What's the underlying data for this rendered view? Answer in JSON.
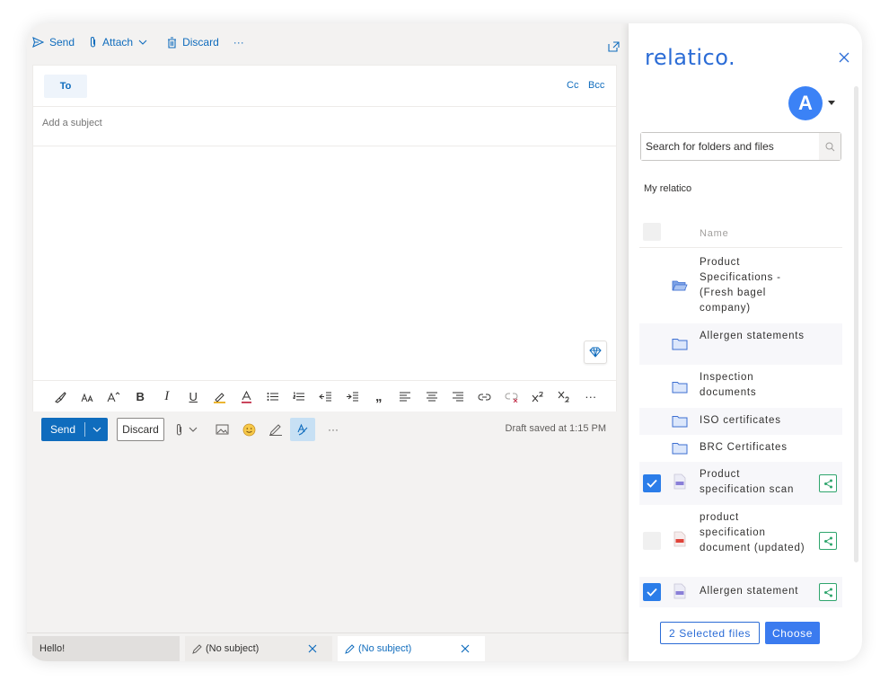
{
  "compose": {
    "commands": {
      "send": "Send",
      "attach": "Attach",
      "discard": "Discard",
      "more": "···"
    },
    "to_label": "To",
    "cc_label": "Cc",
    "bcc_label": "Bcc",
    "subject_placeholder": "Add a subject",
    "format": {
      "bold": "B",
      "italic": "I",
      "underline": "U",
      "quote": "„",
      "more": "···"
    },
    "actions": {
      "send": "Send",
      "discard": "Discard",
      "more": "···"
    },
    "draft_status": "Draft saved at 1:15 PM"
  },
  "tabs": [
    {
      "label": "Hello!"
    },
    {
      "label": "(No subject)"
    },
    {
      "label": "(No subject)"
    }
  ],
  "relatico": {
    "brand": "relatico.",
    "avatar_initial": "A",
    "search_placeholder": "Search for folders and files",
    "section_title": "My relatico",
    "name_header": "Name",
    "items": [
      {
        "label": "Product Specifications - (Fresh bagel company)",
        "type": "folder-open",
        "checked": false
      },
      {
        "label": "Allergen statements",
        "type": "folder",
        "checked": false
      },
      {
        "label": "Inspection documents",
        "type": "folder",
        "checked": false
      },
      {
        "label": "ISO certificates",
        "type": "folder",
        "checked": false
      },
      {
        "label": "BRC Certificates",
        "type": "folder",
        "checked": false
      },
      {
        "label": "Product specification scan",
        "type": "file",
        "checked": true
      },
      {
        "label": "product specification document (updated)",
        "type": "pdf",
        "checked": false
      },
      {
        "label": "Allergen statement",
        "type": "file",
        "checked": true
      }
    ],
    "selected_files": "2 Selected files",
    "choose": "Choose"
  },
  "colors": {
    "outlook_blue": "#0f6cbd",
    "relatico_blue": "#2b6cd6",
    "share_green": "#2fa56d",
    "pdf_red": "#e0443a"
  }
}
